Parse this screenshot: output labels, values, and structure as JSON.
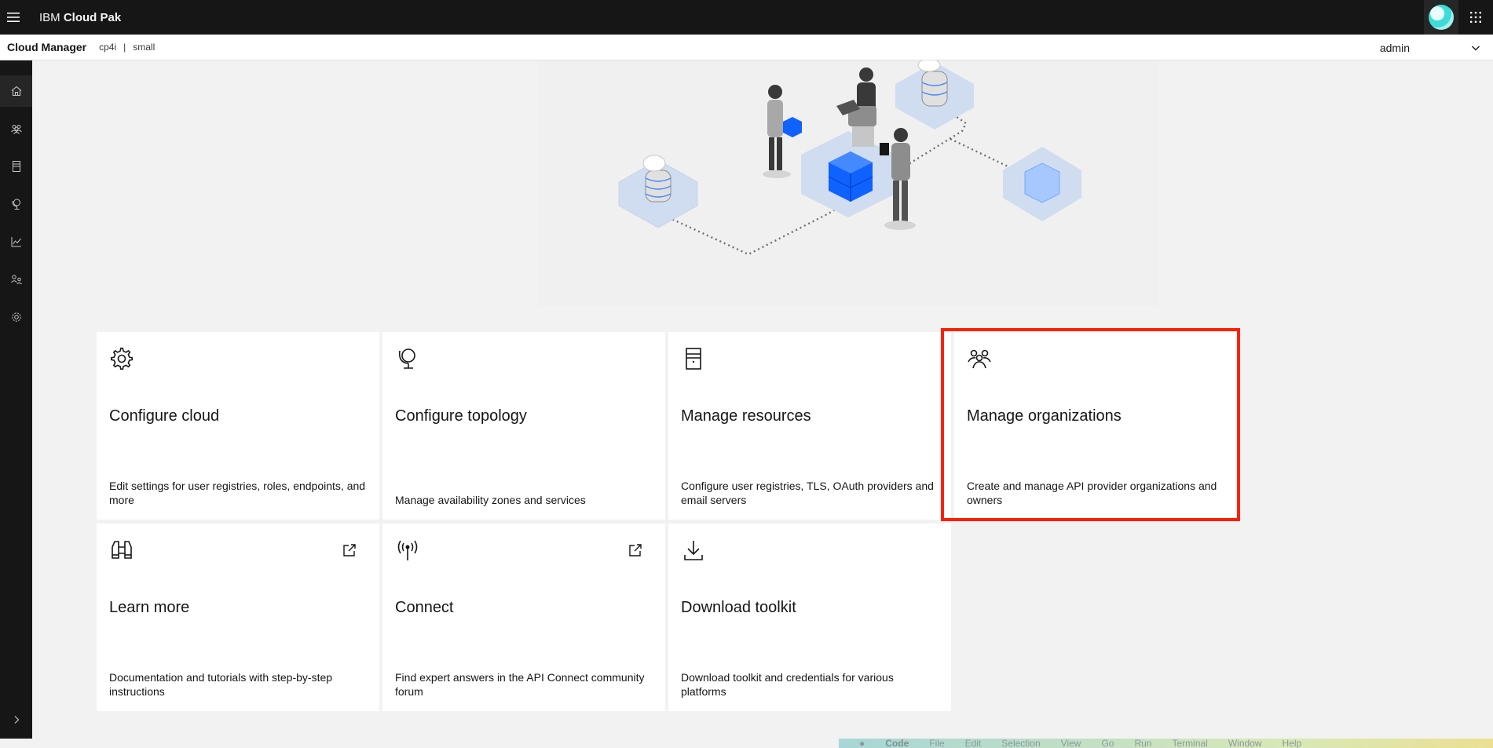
{
  "header": {
    "brand_prefix": "IBM",
    "brand_name": "Cloud Pak",
    "icons": [
      "menu-icon",
      "user-avatar",
      "app-switcher-icon"
    ]
  },
  "subheader": {
    "title": "Cloud Manager",
    "context_1": "cp4i",
    "separator": "|",
    "context_2": "small",
    "user": "admin"
  },
  "sidebar": {
    "items": [
      "home-icon",
      "organizations-icon",
      "resources-icon",
      "topology-icon",
      "analytics-icon",
      "members-icon",
      "settings-icon"
    ],
    "expand_icon": "chevron-right-icon"
  },
  "tiles": [
    {
      "title": "Configure cloud",
      "description": "Edit settings for user registries, roles, endpoints, and more",
      "icon": "gear-icon"
    },
    {
      "title": "Configure topology",
      "description": "Manage availability zones and services",
      "icon": "globe-icon"
    },
    {
      "title": "Manage resources",
      "description": "Configure user registries, TLS, OAuth providers and email servers",
      "icon": "server-icon"
    },
    {
      "title": "Manage organizations",
      "description": "Create and manage API provider organizations and owners",
      "icon": "group-icon"
    },
    {
      "title": "Learn more",
      "description": "Documentation and tutorials with step-by-step instructions",
      "icon": "binoculars-icon"
    },
    {
      "title": "Connect",
      "description": "Find expert answers in the API Connect community forum",
      "icon": "antenna-icon"
    },
    {
      "title": "Download toolkit",
      "description": "Download toolkit and credentials for various platforms",
      "icon": "download-icon"
    }
  ],
  "dock": {
    "items": [
      "Code",
      "File",
      "Edit",
      "Selection",
      "View",
      "Go",
      "Run",
      "Terminal",
      "Window",
      "Help"
    ]
  },
  "colors": {
    "header_bg": "#161616",
    "highlight": "#ff1f00",
    "accent_blue": "#0f62fe"
  }
}
